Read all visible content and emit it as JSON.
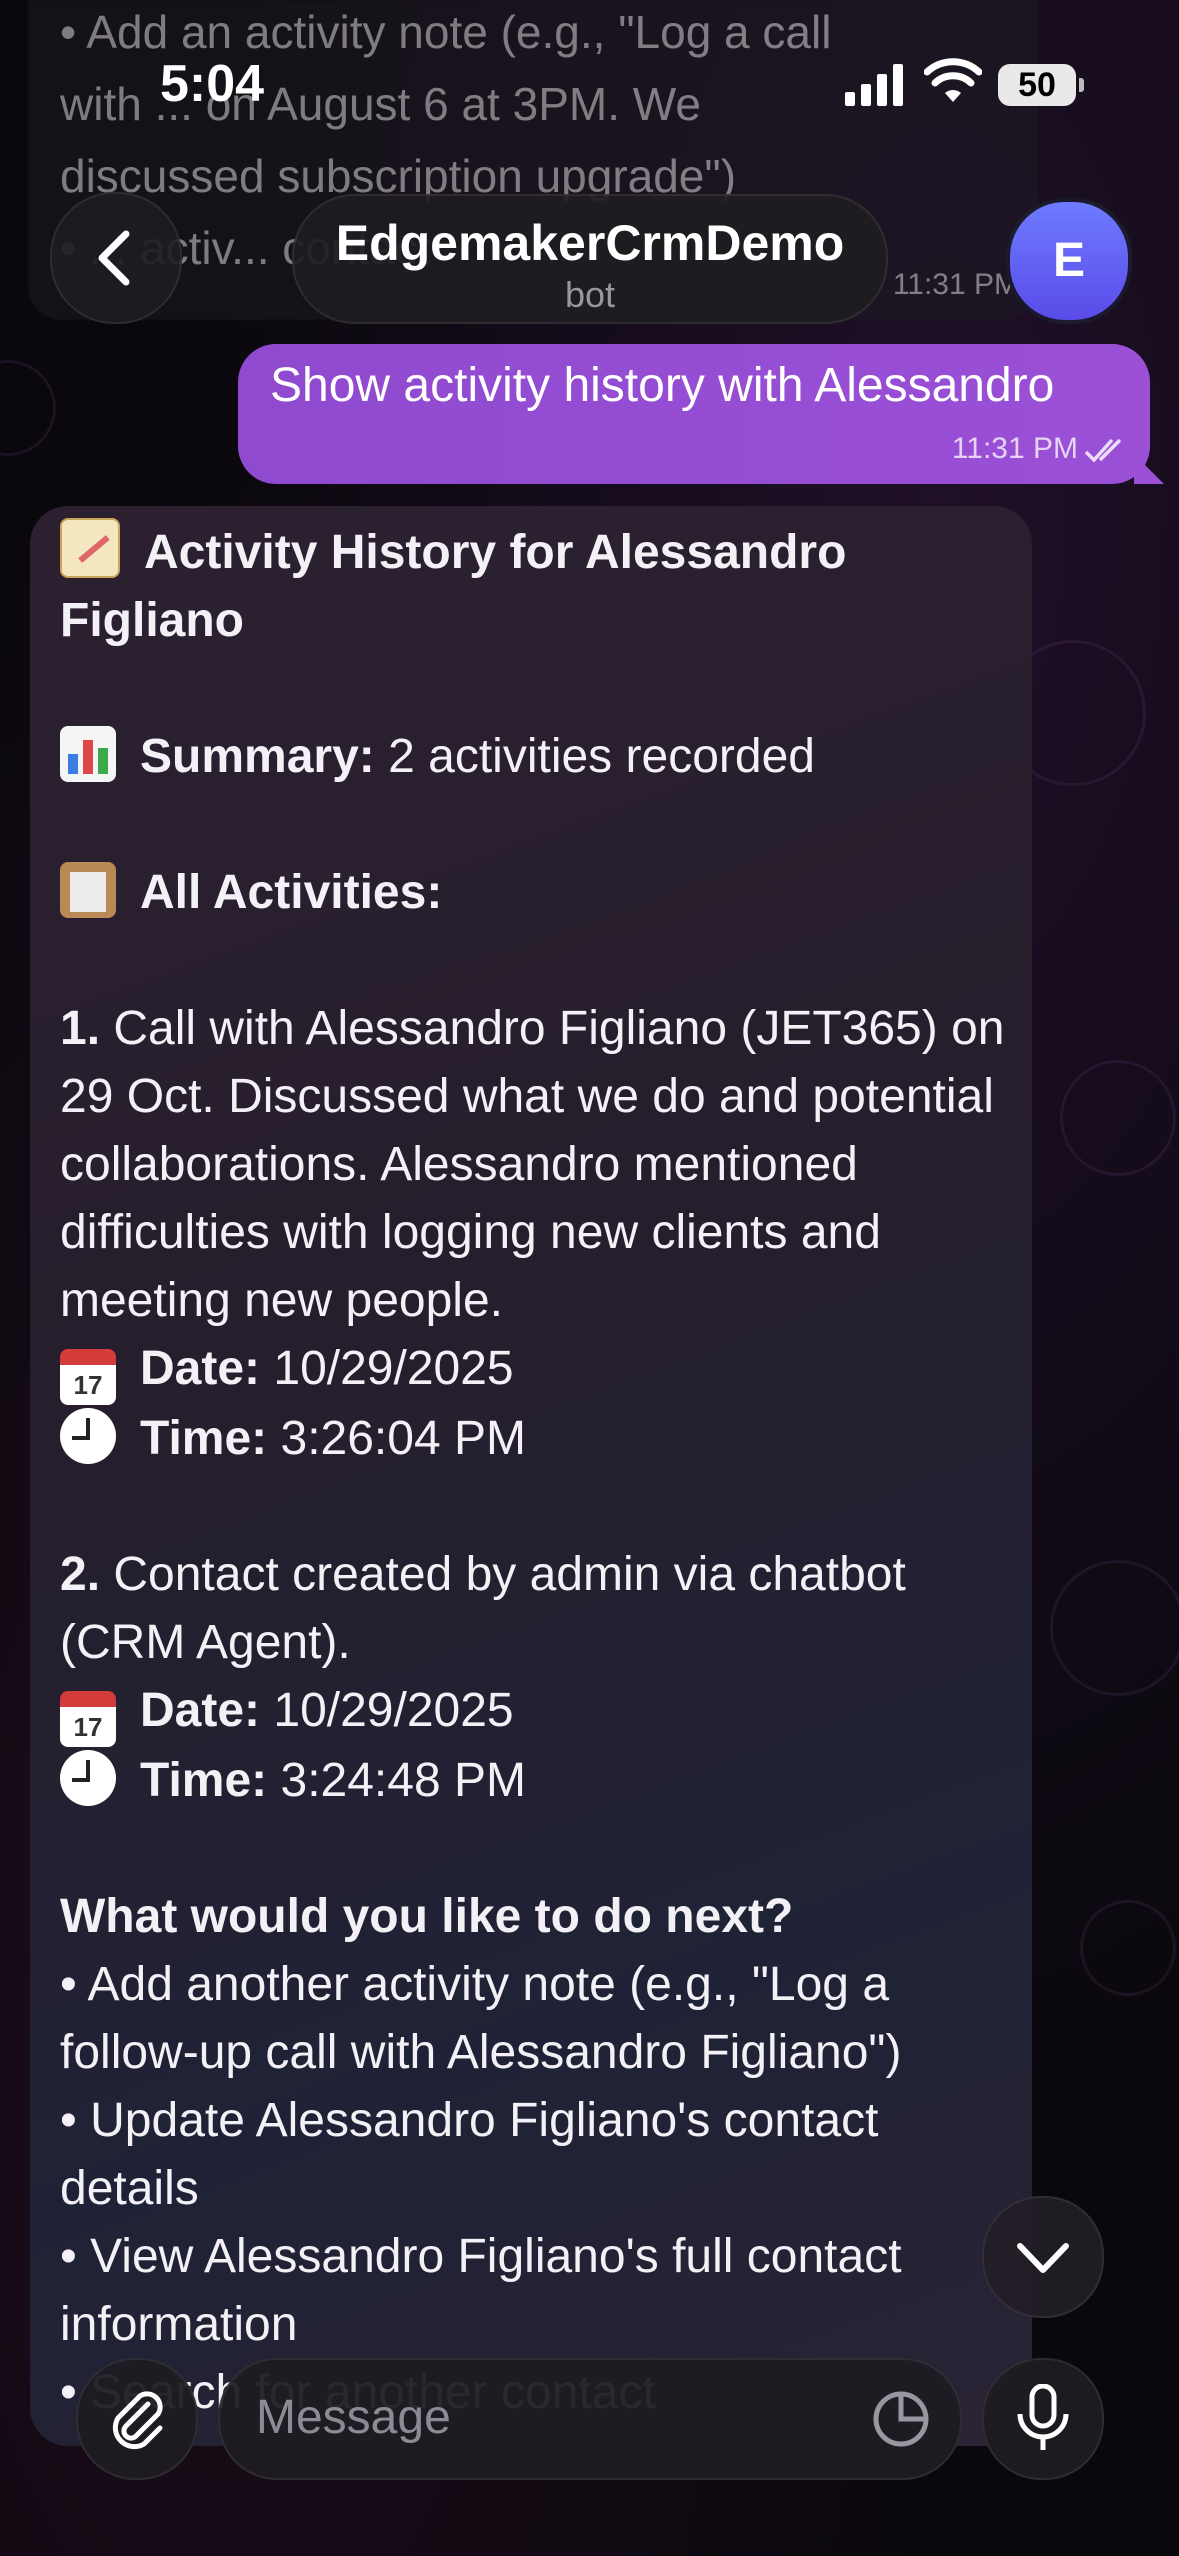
{
  "status_bar": {
    "time": "5:04",
    "battery": "50"
  },
  "prev_message": {
    "lines": "• Add an activity note (e.g., \"Log a call\nwith ... on August 6 at 3PM. We\ndiscussed subscription upgrade\")\n• ... activ... contact",
    "time": "11:31 PM"
  },
  "header": {
    "title": "EdgemakerCrmDemo",
    "subtitle": "bot",
    "avatar_letter": "E"
  },
  "outgoing": {
    "text": "Show activity history with Alessandro",
    "time": "11:31 PM"
  },
  "incoming": {
    "heading": "Activity History for Alessandro Figliano",
    "summary_label": "Summary:",
    "summary_value": " 2 activities recorded",
    "all_label": "All Activities:",
    "activities": [
      {
        "num": "1.",
        "text": " Call with Alessandro Figliano (JET365) on 29 Oct. Discussed what we do and potential collaborations. Alessandro mentioned difficulties with logging new clients and meeting new people.",
        "date_label": "Date:",
        "date": " 10/29/2025",
        "time_label": "Time:",
        "time": " 3:26:04 PM"
      },
      {
        "num": "2.",
        "text": " Contact created by admin via chatbot (CRM Agent).",
        "date_label": "Date:",
        "date": " 10/29/2025",
        "time_label": "Time:",
        "time": " 3:24:48 PM"
      }
    ],
    "next_heading": "What would you like to do next?",
    "next_items": [
      "• Add another activity note (e.g., \"Log a follow-up call with Alessandro Figliano\")",
      "• Update Alessandro Figliano's contact details",
      "• View Alessandro Figliano's full contact information",
      "• Search for another contact"
    ],
    "calendar_day": "17"
  },
  "input": {
    "placeholder": "Message"
  }
}
